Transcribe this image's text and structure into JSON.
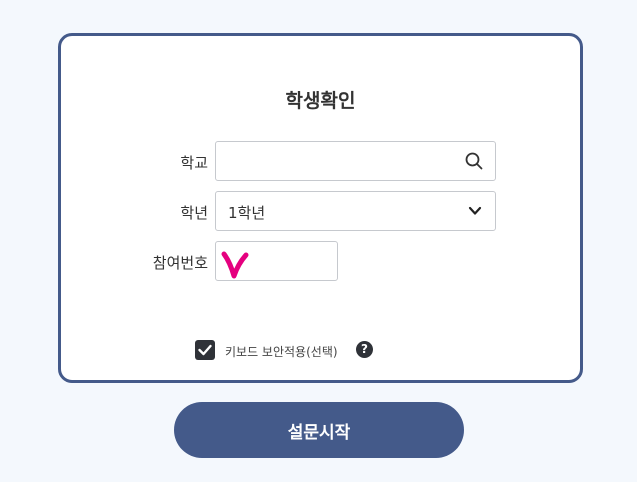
{
  "form": {
    "title": "학생확인",
    "school": {
      "label": "학교",
      "value": "",
      "placeholder": ""
    },
    "grade": {
      "label": "학년",
      "selected": "1학년"
    },
    "participant_number": {
      "label": "참여번호",
      "value": ""
    },
    "keyboard_security": {
      "label": "키보드 보안적용(선택)",
      "checked": true,
      "help": "?"
    }
  },
  "start_button": {
    "label": "설문시작"
  },
  "colors": {
    "primary": "#445a8a",
    "page_background": "#f4f8fd",
    "annotation": "#e5007f"
  },
  "icons": {
    "school_field": "search-icon",
    "grade_field": "chevron-down-icon",
    "checkbox": "check-icon",
    "help": "help-icon"
  }
}
